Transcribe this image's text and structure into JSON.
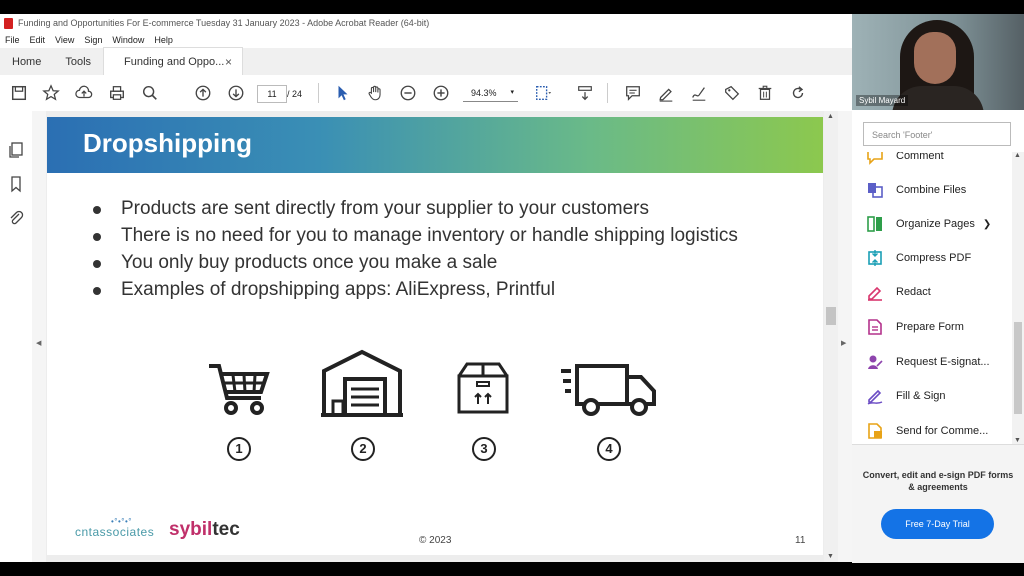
{
  "window": {
    "title": "Funding and Opportunities For E-commerce  Tuesday 31 January 2023 - Adobe Acrobat Reader (64-bit)"
  },
  "menu": [
    "File",
    "Edit",
    "View",
    "Sign",
    "Window",
    "Help"
  ],
  "tabs": {
    "home": "Home",
    "tools": "Tools",
    "doc": "Funding and Oppo...",
    "close": "×"
  },
  "toolbar": {
    "page_current": "11",
    "page_total": "/ 24",
    "zoom": "94.3%",
    "zoom_arrow": "▾"
  },
  "slide": {
    "title": "Dropshipping",
    "bullets": [
      "Products are sent directly from your supplier to your customers",
      "There is no need for you to manage inventory or handle shipping logistics",
      "You only buy products once you make a sale",
      "Examples of dropshipping apps: AliExpress, Printful"
    ],
    "steps": [
      "1",
      "2",
      "3",
      "4"
    ],
    "logo_left": "cntassociates",
    "logo_right_a": "sybil",
    "logo_right_b": "tec",
    "copyright": "© 2023",
    "page_number": "11"
  },
  "webcam": {
    "name": "Sybil Mayard"
  },
  "right_panel": {
    "search_placeholder": "Search 'Footer'",
    "tools": [
      {
        "label": "Comment",
        "icon": "comment-icon",
        "color": "#e8a317"
      },
      {
        "label": "Combine Files",
        "icon": "combine-files-icon",
        "color": "#5b5fc7"
      },
      {
        "label": "Organize Pages",
        "icon": "organize-pages-icon",
        "color": "#2e9e4a"
      },
      {
        "label": "Compress PDF",
        "icon": "compress-pdf-icon",
        "color": "#1a9fb5"
      },
      {
        "label": "Redact",
        "icon": "redact-icon",
        "color": "#d9376e"
      },
      {
        "label": "Prepare Form",
        "icon": "prepare-form-icon",
        "color": "#b4328c"
      },
      {
        "label": "Request E-signat...",
        "icon": "request-esign-icon",
        "color": "#8e44ad"
      },
      {
        "label": "Fill & Sign",
        "icon": "fill-sign-icon",
        "color": "#6b4cc4"
      },
      {
        "label": "Send for Comme...",
        "icon": "send-comment-icon",
        "color": "#e8a317"
      }
    ],
    "promo_text": "Convert, edit and e-sign PDF forms & agreements",
    "promo_button": "Free 7-Day Trial"
  },
  "colors": {
    "accent": "#1473e6",
    "brand_red": "#d32020",
    "banner_start": "#2b6fb3",
    "banner_end": "#8cc84e"
  }
}
